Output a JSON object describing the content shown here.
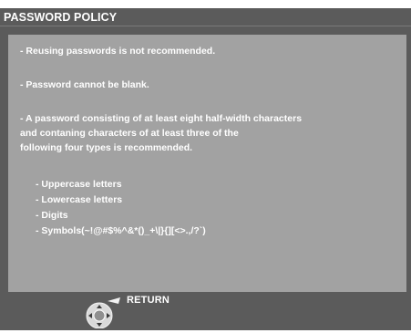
{
  "dialog": {
    "title": "PASSWORD POLICY",
    "lines": [
      "- Reusing passwords is not recommended.",
      "- Password cannot be blank.",
      "- A password consisting of at least eight half-width characters",
      "and contaning characters of at least three of the",
      "following four types is recommended.",
      "- Uppercase letters",
      "- Lowercase letters",
      "- Digits",
      "- Symbols(~!@#$%^&*()_+\\|}{][<>.,/?`)"
    ]
  },
  "footer": {
    "return_label": "RETURN",
    "return_icon": "directional-pad-icon"
  },
  "colors": {
    "frame": "#5b5b5b",
    "panel": "#a2a2a2",
    "text": "#ffffff"
  }
}
